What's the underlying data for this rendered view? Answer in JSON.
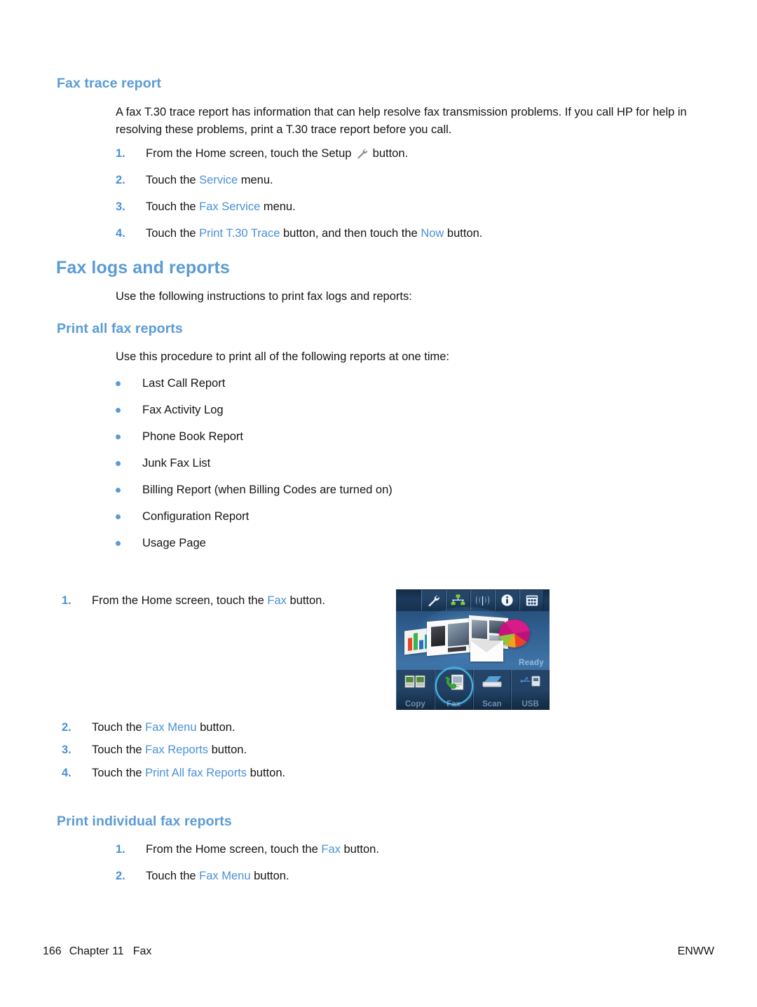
{
  "sections": {
    "fax_trace_report": {
      "heading": "Fax trace report",
      "intro": "A fax T.30 trace report has information that can help resolve fax transmission problems. If you call HP for help in resolving these problems, print a T.30 trace report before you call.",
      "steps": [
        {
          "num": "1.",
          "pre": "From the Home screen, touch the Setup ",
          "link": "",
          "post": " button.",
          "icon": "wrench-icon"
        },
        {
          "num": "2.",
          "pre": "Touch the ",
          "link": "Service",
          "post": " menu."
        },
        {
          "num": "3.",
          "pre": "Touch the ",
          "link": "Fax Service",
          "post": " menu."
        },
        {
          "num": "4.",
          "pre": "Touch the ",
          "link": "Print T.30 Trace",
          "post": " button, and then touch the ",
          "link2": "Now",
          "post2": " button."
        }
      ]
    },
    "fax_logs_and_reports": {
      "heading": "Fax logs and reports",
      "intro": "Use the following instructions to print fax logs and reports:"
    },
    "print_all_fax_reports": {
      "heading": "Print all fax reports",
      "intro": "Use this procedure to print all of the following reports at one time:",
      "bullets": [
        "Last Call Report",
        "Fax Activity Log",
        "Phone Book Report",
        "Junk Fax List",
        "Billing Report (when Billing Codes are turned on)",
        "Configuration Report",
        "Usage Page"
      ],
      "steps": [
        {
          "num": "1.",
          "pre": "From the Home screen, touch the ",
          "link": "Fax",
          "post": " button."
        },
        {
          "num": "2.",
          "pre": "Touch the ",
          "link": "Fax Menu",
          "post": " button."
        },
        {
          "num": "3.",
          "pre": "Touch the ",
          "link": "Fax Reports",
          "post": " button."
        },
        {
          "num": "4.",
          "pre": "Touch the ",
          "link": "Print All fax Reports",
          "post": " button."
        }
      ]
    },
    "print_individual_fax_reports": {
      "heading": "Print individual fax reports",
      "steps": [
        {
          "num": "1.",
          "pre": "From the Home screen, touch the ",
          "link": "Fax",
          "post": " button."
        },
        {
          "num": "2.",
          "pre": "Touch the ",
          "link": "Fax Menu",
          "post": " button."
        }
      ]
    }
  },
  "control_panel": {
    "status_text": "Ready",
    "top_icons": [
      {
        "name": "wrench-setup-icon",
        "label": "Setup"
      },
      {
        "name": "network-icon",
        "label": "Network"
      },
      {
        "name": "wireless-icon",
        "label": "Wireless"
      },
      {
        "name": "info-icon",
        "label": "Information"
      },
      {
        "name": "supplies-levels-icon",
        "label": "Supplies"
      }
    ],
    "bottom_buttons": [
      {
        "name": "copy-button",
        "label": "Copy",
        "highlighted": false
      },
      {
        "name": "fax-button",
        "label": "Fax",
        "highlighted": true
      },
      {
        "name": "scan-button",
        "label": "Scan",
        "highlighted": false
      },
      {
        "name": "usb-button",
        "label": "USB",
        "highlighted": false
      }
    ]
  },
  "footer": {
    "page_number": "166",
    "chapter": "Chapter 11",
    "chapter_title": "Fax",
    "locale": "ENWW"
  },
  "colors": {
    "heading_blue": "#5b9bd5",
    "link_blue": "#4a90d9",
    "bullet_blue": "#5b9bd5",
    "text_black": "#151515",
    "highlight_cyan": "#49b6e8"
  }
}
